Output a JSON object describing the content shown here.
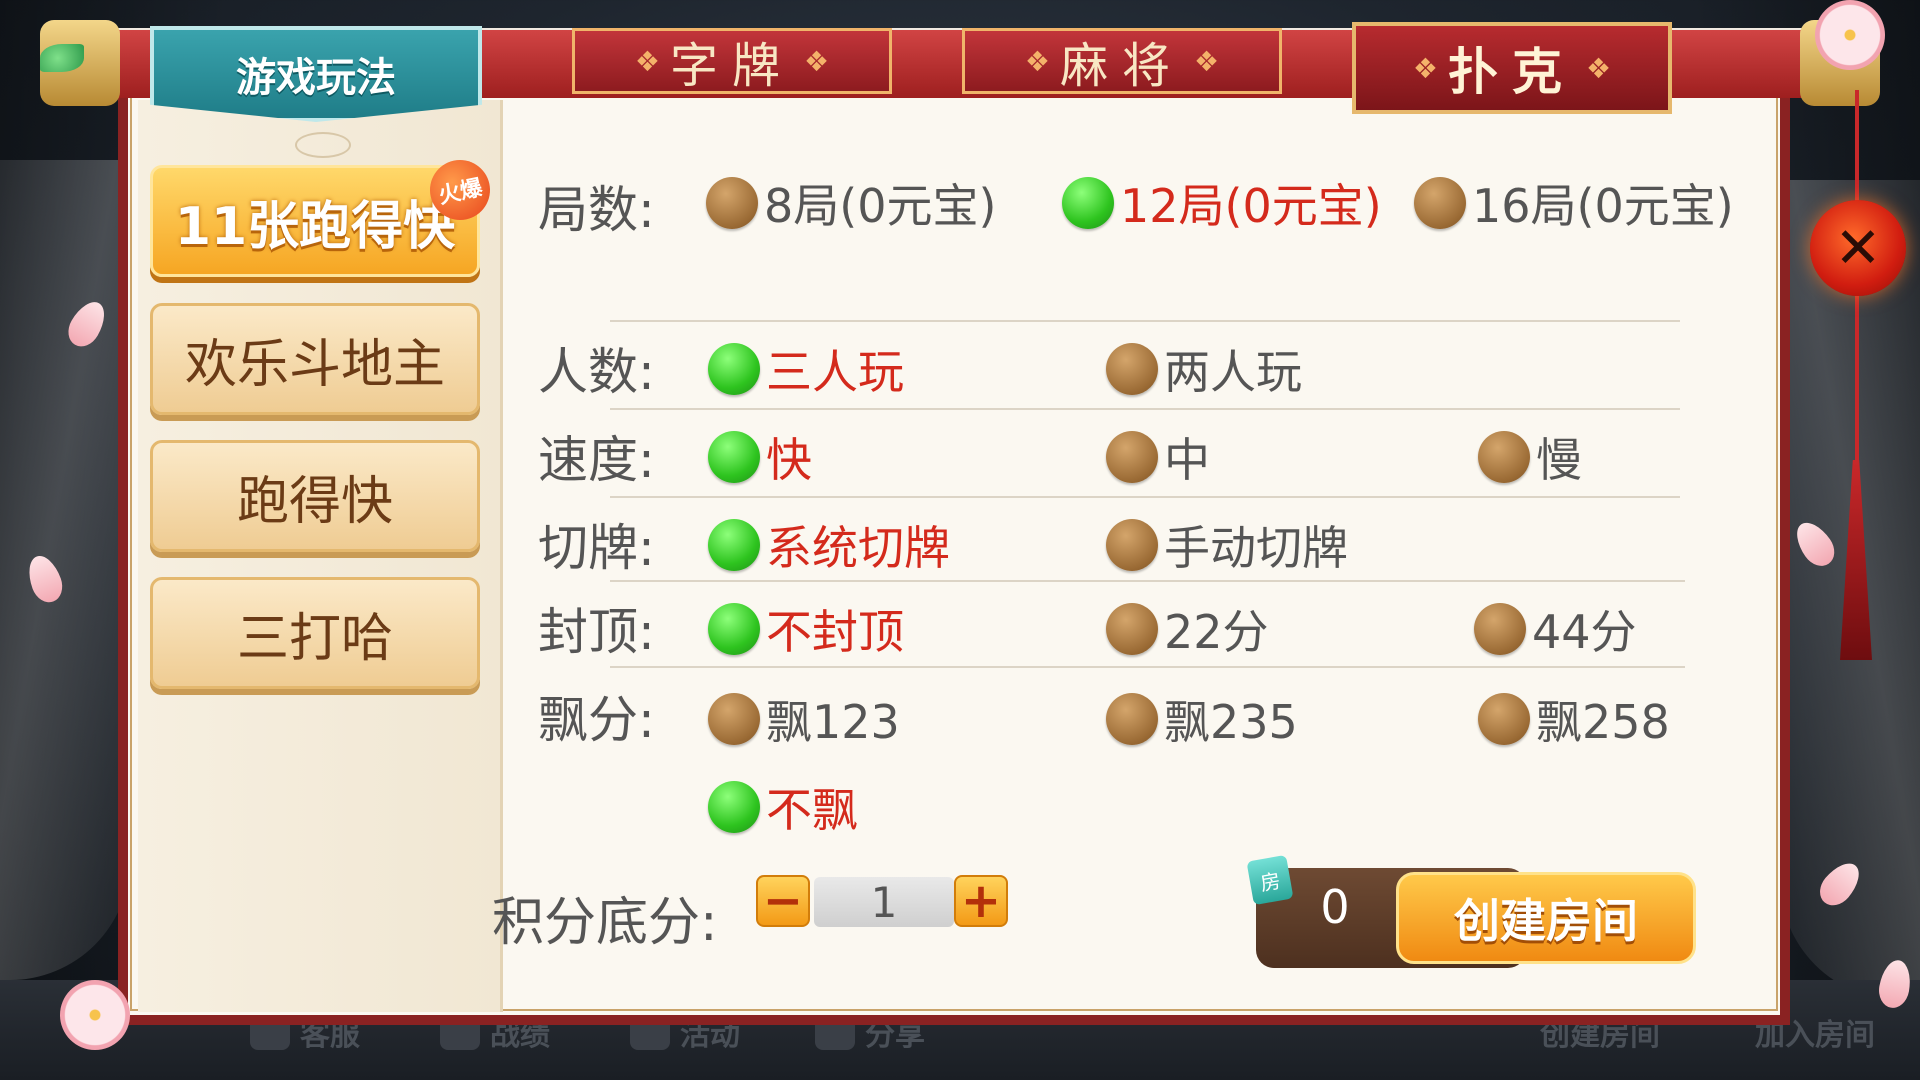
{
  "tabs": {
    "gameplay": "游戏玩法",
    "zipai": "字牌",
    "mahjong": "麻将",
    "poker": "扑克",
    "ornament": "❖"
  },
  "modes": {
    "items": [
      "11张跑得快",
      "欢乐斗地主",
      "跑得快",
      "三打哈"
    ],
    "active_index": 0,
    "hot_badge": "火爆"
  },
  "options": {
    "rounds": {
      "label": "局数:",
      "choices": [
        "8局(0元宝)",
        "12局(0元宝)",
        "16局(0元宝)"
      ],
      "selected": 1
    },
    "players": {
      "label": "人数:",
      "choices": [
        "三人玩",
        "两人玩"
      ],
      "selected": 0
    },
    "speed": {
      "label": "速度:",
      "choices": [
        "快",
        "中",
        "慢"
      ],
      "selected": 0
    },
    "cut": {
      "label": "切牌:",
      "choices": [
        "系统切牌",
        "手动切牌"
      ],
      "selected": 0
    },
    "cap": {
      "label": "封顶:",
      "choices": [
        "不封顶",
        "22分",
        "44分"
      ],
      "selected": 0
    },
    "float": {
      "label": "飘分:",
      "choices": [
        "飘123",
        "飘235",
        "飘258",
        "不飘"
      ],
      "selected": 3
    }
  },
  "score": {
    "label": "积分底分:",
    "value": "1",
    "minus": "−",
    "plus": "+"
  },
  "room": {
    "icon_text": "房",
    "count": "0",
    "create_label": "创建房间"
  },
  "close": "✕",
  "bottom_bar": [
    "客服",
    "战绩",
    "活动",
    "分享",
    "创建房间",
    "加入房间"
  ],
  "colors": {
    "selected_text": "#d42a1c",
    "panel_border": "#8a2222",
    "active_mode": "#f6a623"
  }
}
